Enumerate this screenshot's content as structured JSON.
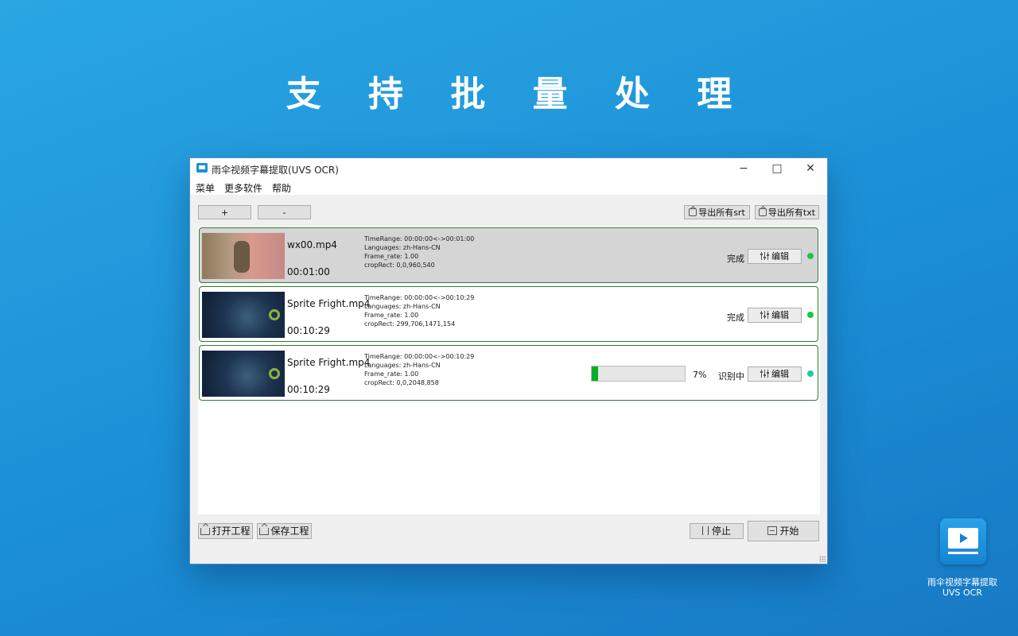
{
  "headline": "支 持 批 量 处 理",
  "window": {
    "title": "雨伞视频字幕提取(UVS OCR)",
    "controls": {
      "minimize": "−",
      "maximize": "□",
      "close": "✕"
    }
  },
  "menu": [
    "菜单",
    "更多软件",
    "帮助"
  ],
  "toolbar": {
    "add": "+",
    "remove": "-",
    "export_srt": "导出所有srt",
    "export_txt": "导出所有txt"
  },
  "tasks": [
    {
      "filename": "wx00.mp4",
      "duration": "00:01:00",
      "time_range": "TimeRange: 00:00:00<->00:01:00",
      "languages": "Languages: zh-Hans-CN",
      "frame_rate": "Frame_rate: 1.00",
      "crop_rect": "cropRect: 0,0,960,540",
      "status": "完成",
      "edit": "编辑",
      "dot_color": "#1ec44a"
    },
    {
      "filename": "Sprite Fright.mp4",
      "duration": "00:10:29",
      "time_range": "TimeRange: 00:00:00<->00:10:29",
      "languages": "Languages: zh-Hans-CN",
      "frame_rate": "Frame_rate: 1.00",
      "crop_rect": "cropRect: 299,706,1471,154",
      "status": "完成",
      "edit": "编辑",
      "dot_color": "#1ec44a"
    },
    {
      "filename": "Sprite Fright.mp4",
      "duration": "00:10:29",
      "time_range": "TimeRange: 00:00:00<->00:10:29",
      "languages": "Languages: zh-Hans-CN",
      "frame_rate": "Frame_rate: 1.00",
      "crop_rect": "cropRect: 0,0,2048,858",
      "status": "识别中",
      "edit": "编辑",
      "progress_percent": 7,
      "progress_label": "7%",
      "dot_color": "#26c6a0"
    }
  ],
  "bottom": {
    "open_project": "打开工程",
    "save_project": "保存工程",
    "stop": "停止",
    "start": "开始"
  },
  "brand": {
    "name": "雨伞视频字幕提取",
    "sub": "UVS OCR"
  },
  "colors": {
    "accent": "#1a8fd8",
    "task_border": "#2e7d32",
    "progress": "#06b025"
  }
}
